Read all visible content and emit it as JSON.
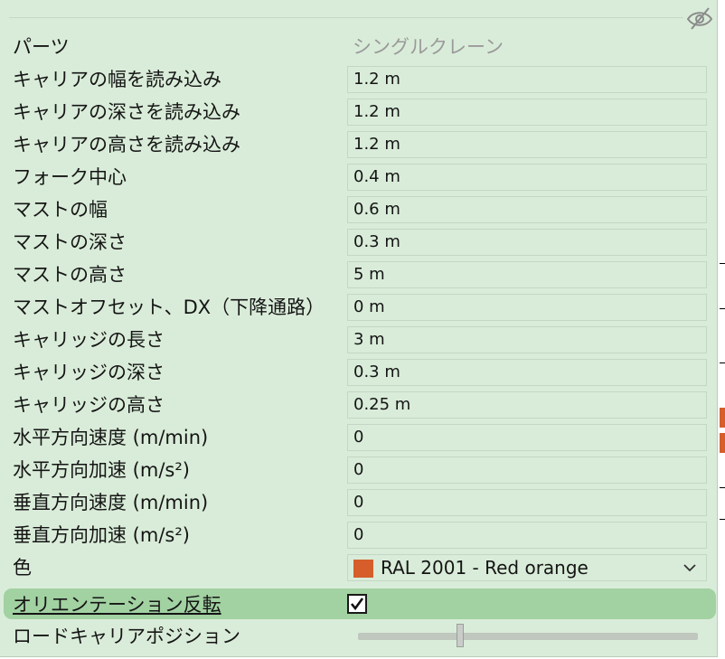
{
  "panel": {
    "header": {
      "label": "パーツ",
      "value": "シングルクレーン"
    },
    "rows": [
      {
        "label": "キャリアの幅を読み込み",
        "value": "1.2 m"
      },
      {
        "label": "キャリアの深さを読み込み",
        "value": "1.2 m"
      },
      {
        "label": "キャリアの高さを読み込み",
        "value": "1.2 m"
      },
      {
        "label": "フォーク中心",
        "value": "0.4 m"
      },
      {
        "label": "マストの幅",
        "value": "0.6 m"
      },
      {
        "label": "マストの深さ",
        "value": "0.3 m"
      },
      {
        "label": "マストの高さ",
        "value": "5 m"
      },
      {
        "label": "マストオフセット、DX（下降通路）",
        "value": "0 m"
      },
      {
        "label": "キャリッジの長さ",
        "value": "3 m"
      },
      {
        "label": "キャリッジの深さ",
        "value": "0.3 m"
      },
      {
        "label": "キャリッジの高さ",
        "value": "0.25 m"
      },
      {
        "label": "水平方向速度 (m/min)",
        "value": "0"
      },
      {
        "label": "水平方向加速 (m/s²)",
        "value": "0"
      },
      {
        "label": "垂直方向速度 (m/min)",
        "value": "0"
      },
      {
        "label": "垂直方向加速 (m/s²)",
        "value": "0"
      }
    ],
    "color": {
      "label": "色",
      "value": "RAL 2001 - Red orange",
      "swatch": "#d55e2b"
    },
    "orientation": {
      "label": "オリエンテーション反転",
      "checked": true
    },
    "load_carrier_position": {
      "label": "ロードキャリアポジション",
      "slider_fraction": 0.3
    }
  },
  "icons": {
    "visibility": "eye-slash-icon",
    "dropdown": "chevron-down-icon",
    "check": "checkmark-icon"
  },
  "colors": {
    "panel_bg": "#d9ecd9",
    "highlight": "#a2d1a2",
    "accent": "#d55e2b"
  }
}
